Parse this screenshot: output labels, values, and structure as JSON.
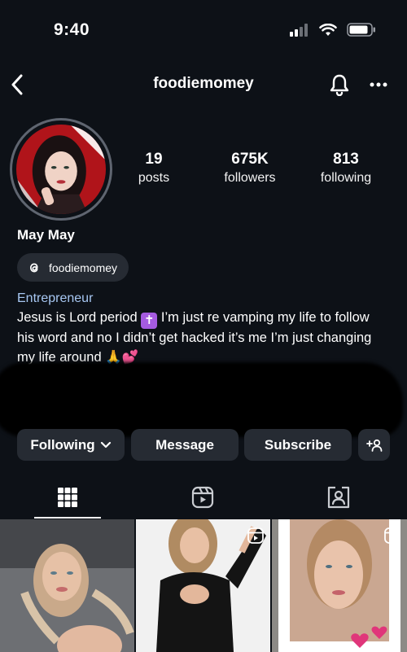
{
  "status_bar": {
    "time": "9:40"
  },
  "nav": {
    "title": "foodiemomey"
  },
  "profile": {
    "display_name": "May May",
    "threads_handle": "foodiemomey",
    "category": "Entrepreneur",
    "bio_part1": "Jesus is Lord period",
    "bio_emoji_cross": "✝",
    "bio_part2": "I’m just re vamping my life to follow his word and no I didn’t get hacked it’s me I’m just changing my life around",
    "bio_emoji_end": "🙏💕"
  },
  "stats": [
    {
      "value": "19",
      "label": "posts"
    },
    {
      "value": "675K",
      "label": "followers"
    },
    {
      "value": "813",
      "label": "following"
    }
  ],
  "actions": {
    "following_label": "Following",
    "message_label": "Message",
    "subscribe_label": "Subscribe"
  },
  "icons": {
    "back": "chevron-left-icon",
    "bell": "bell-icon",
    "more": "more-horizontal-icon",
    "threads": "threads-icon",
    "add_person": "add-person-icon",
    "grid": "grid-icon",
    "reels": "reels-icon",
    "tagged": "tagged-icon"
  },
  "colors": {
    "background": "#0d1117",
    "chip": "#262b33",
    "category": "#a7c7f2"
  }
}
